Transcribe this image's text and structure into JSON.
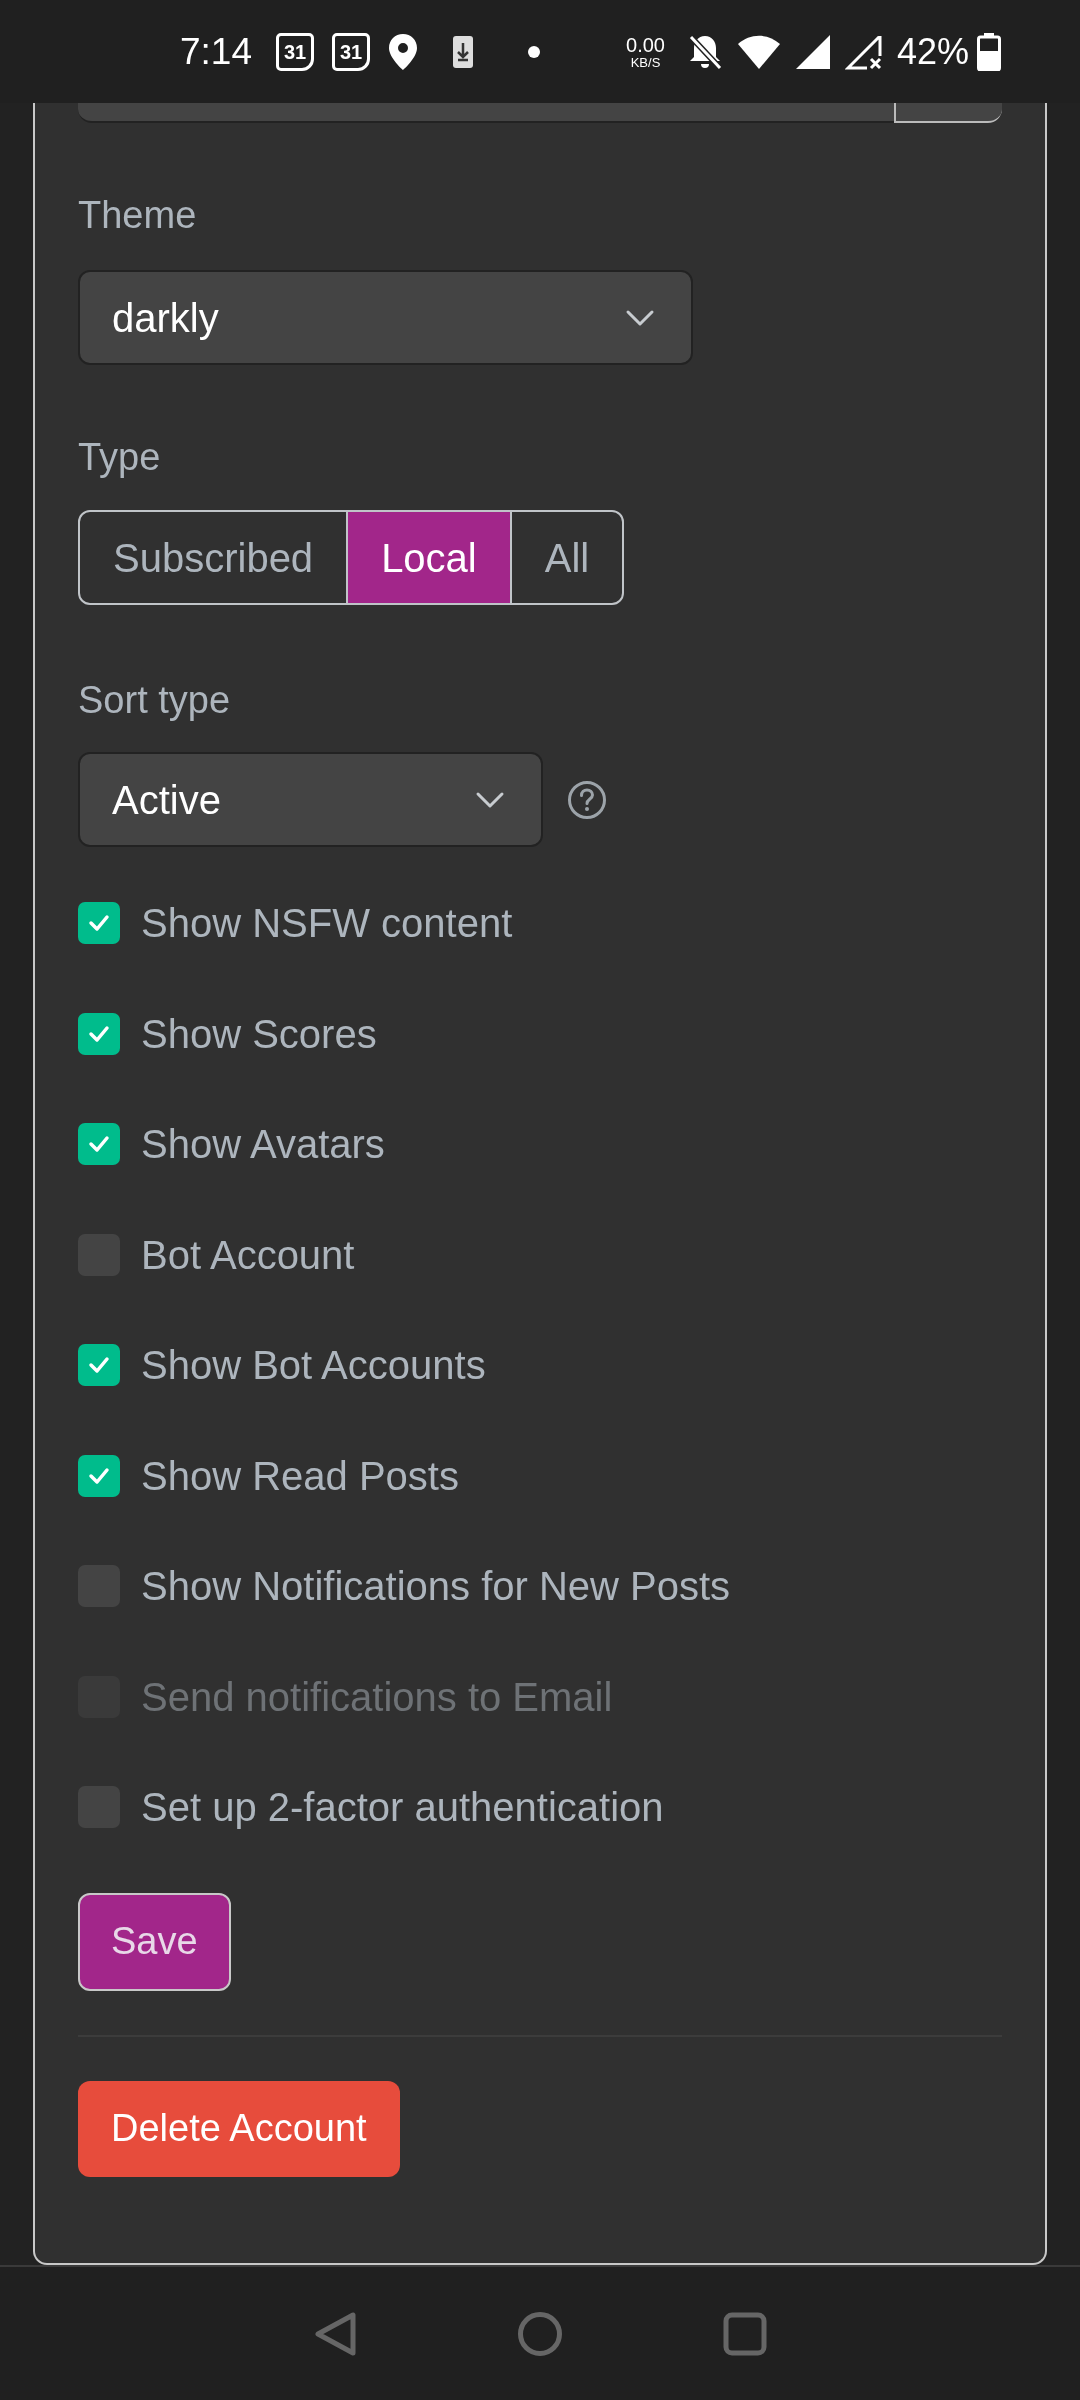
{
  "status_bar": {
    "time": "7:14",
    "calendar_badges": [
      "31",
      "31"
    ],
    "net_speed": "0.00",
    "net_unit": "KB/S",
    "battery": "42%"
  },
  "theme": {
    "label": "Theme",
    "value": "darkly"
  },
  "type": {
    "label": "Type",
    "options": [
      {
        "label": "Subscribed",
        "selected": false
      },
      {
        "label": "Local",
        "selected": true
      },
      {
        "label": "All",
        "selected": false
      }
    ]
  },
  "sort_type": {
    "label": "Sort type",
    "value": "Active"
  },
  "options": [
    {
      "label": "Show NSFW content",
      "checked": true,
      "disabled": false
    },
    {
      "label": "Show Scores",
      "checked": true,
      "disabled": false
    },
    {
      "label": "Show Avatars",
      "checked": true,
      "disabled": false
    },
    {
      "label": "Bot Account",
      "checked": false,
      "disabled": false
    },
    {
      "label": "Show Bot Accounts",
      "checked": true,
      "disabled": false
    },
    {
      "label": "Show Read Posts",
      "checked": true,
      "disabled": false
    },
    {
      "label": "Show Notifications for New Posts",
      "checked": false,
      "disabled": false
    },
    {
      "label": "Send notifications to Email",
      "checked": false,
      "disabled": true
    },
    {
      "label": "Set up 2-factor authentication",
      "checked": false,
      "disabled": false
    }
  ],
  "save_button": "Save",
  "delete_button": "Delete Account"
}
